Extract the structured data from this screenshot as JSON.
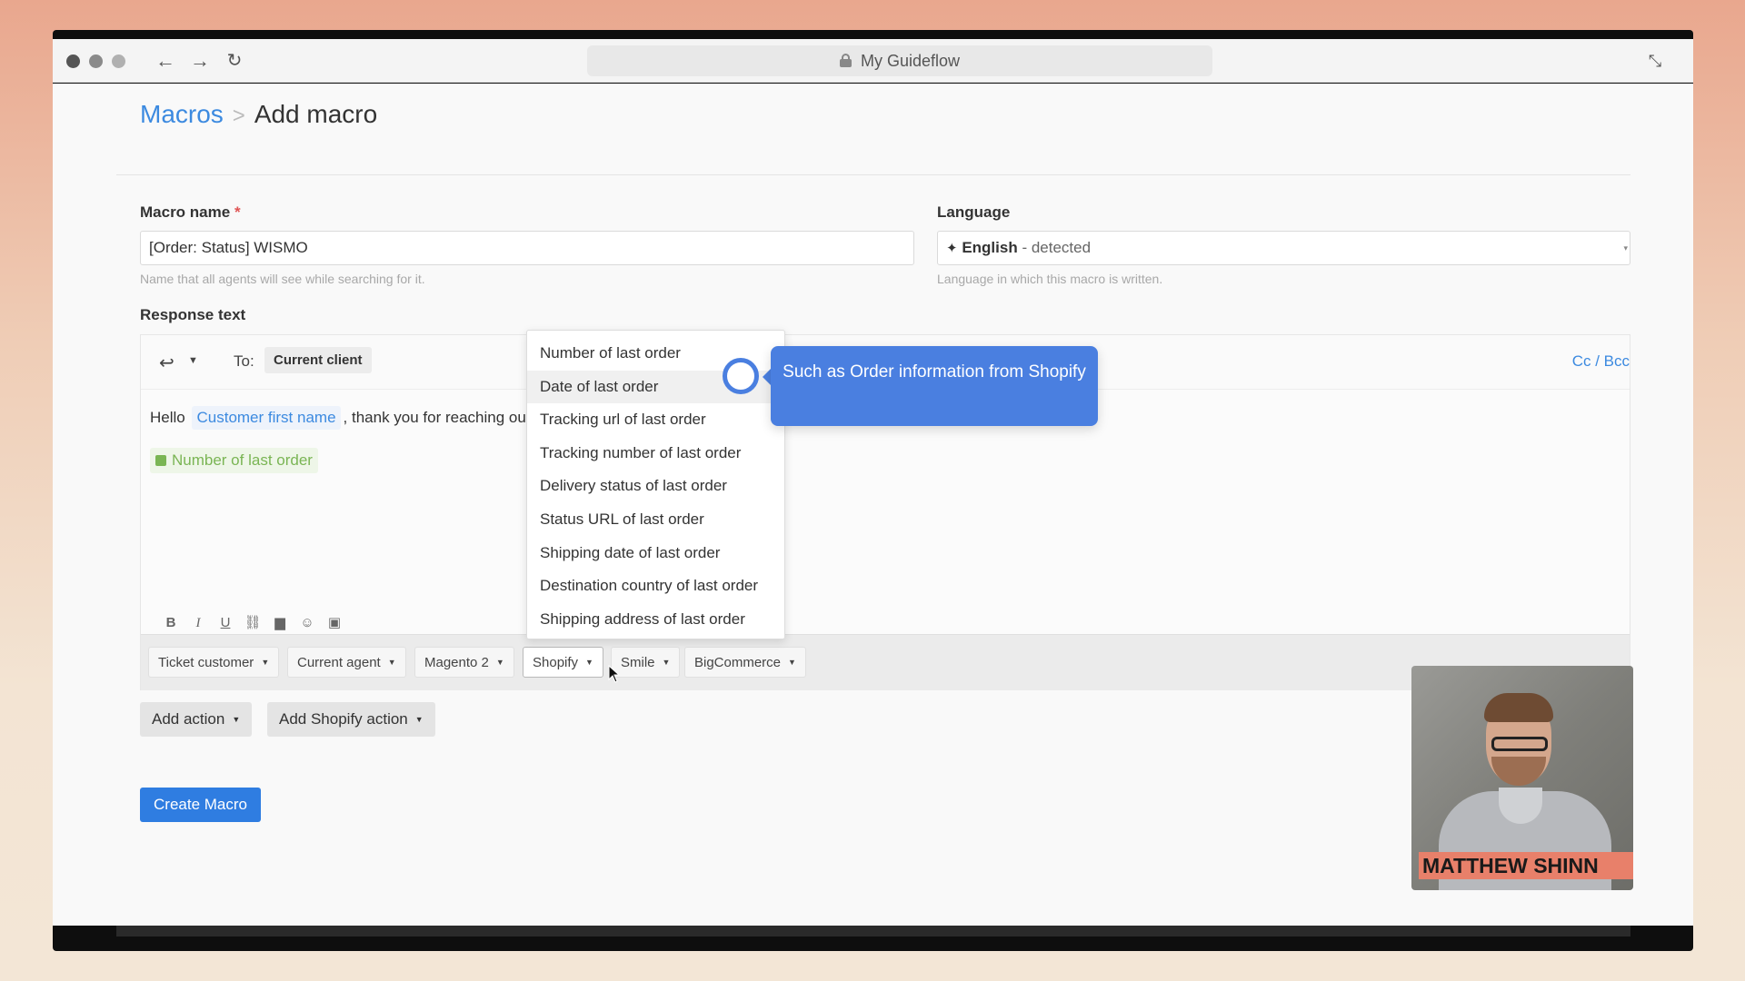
{
  "browser": {
    "url_title": "My Guideflow",
    "dot_colors": [
      "#555555",
      "#8a8a8a",
      "#b0b0b0"
    ]
  },
  "breadcrumb": {
    "parent": "Macros",
    "separator": ">",
    "current": "Add macro"
  },
  "form": {
    "macro_name": {
      "label": "Macro name",
      "required_mark": "*",
      "value": "[Order: Status] WISMO",
      "help": "Name that all agents will see while searching for it."
    },
    "language": {
      "label": "Language",
      "value": "English",
      "suffix": "- detected",
      "help": "Language in which this macro is written."
    },
    "response_text": {
      "label": "Response text",
      "to_label": "To:",
      "to_chip": "Current client",
      "cc_bcc": "Cc / Bcc",
      "body_hello": "Hello",
      "body_var": "Customer first name",
      "body_rest": ", thank you for reaching ou",
      "shopify_var": "Number of last order"
    }
  },
  "variable_bar": [
    {
      "label": "Ticket customer"
    },
    {
      "label": "Current agent"
    },
    {
      "label": "Magento 2"
    },
    {
      "label": "Shopify",
      "active": true
    },
    {
      "label": "Smile"
    },
    {
      "label": "BigCommerce"
    }
  ],
  "dropdown": {
    "items": [
      "Number of last order",
      "Date of last order",
      "Tracking url of last order",
      "Tracking number of last order",
      "Delivery status of last order",
      "Status URL of last order",
      "Shipping date of last order",
      "Destination country of last order",
      "Shipping address of last order"
    ],
    "hover_index": 1
  },
  "tooltip": {
    "text": "Such as Order information from Shopify"
  },
  "actions": {
    "add_action": "Add action",
    "add_shopify_action": "Add Shopify action",
    "create": "Create Macro"
  },
  "webcam": {
    "name": "MATTHEW SHINN"
  },
  "colors": {
    "accent_blue": "#2f7de1",
    "link_blue": "#3c8ae0",
    "tooltip_blue": "#4a7fe0",
    "shopify_green": "#7ab554",
    "name_banner": "#e8806a"
  }
}
